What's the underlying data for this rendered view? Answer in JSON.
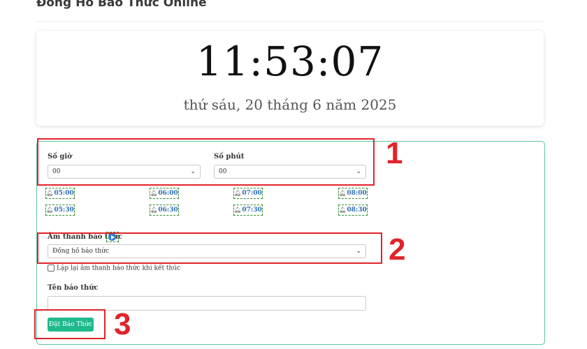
{
  "page_title": "Đồng Hồ Báo Thức Online",
  "clock": {
    "time": "11:53:07",
    "date": "thứ sáu, 20 tháng 6 năm 2025"
  },
  "form": {
    "hour_label": "Số giờ",
    "hour_value": "00",
    "minute_label": "Số phút",
    "minute_value": "00",
    "presets": [
      "05:00",
      "06:00",
      "07:00",
      "08:00",
      "05:30",
      "06:30",
      "07:30",
      "08:30"
    ],
    "sound_label": "Âm thanh báo thức",
    "sound_value": "Đồng hồ báo thức",
    "repeat_label": "Lặp lại âm thanh báo thức khi kết thúc",
    "repeat_checked": false,
    "name_label": "Tên báo thức",
    "name_value": "",
    "submit_label": "Đặt Báo Thức"
  },
  "callouts": [
    "1",
    "2",
    "3"
  ],
  "colors": {
    "accent": "#1eb98d",
    "panel_border": "#5fc3a2",
    "preset_border": "#2f8f2f",
    "preset_text": "#2d6fb7",
    "callout": "#e0232a"
  },
  "icons": {
    "preset": "bell-icon",
    "sound_preview": "play-icon",
    "select": "chevron-down-icon"
  }
}
